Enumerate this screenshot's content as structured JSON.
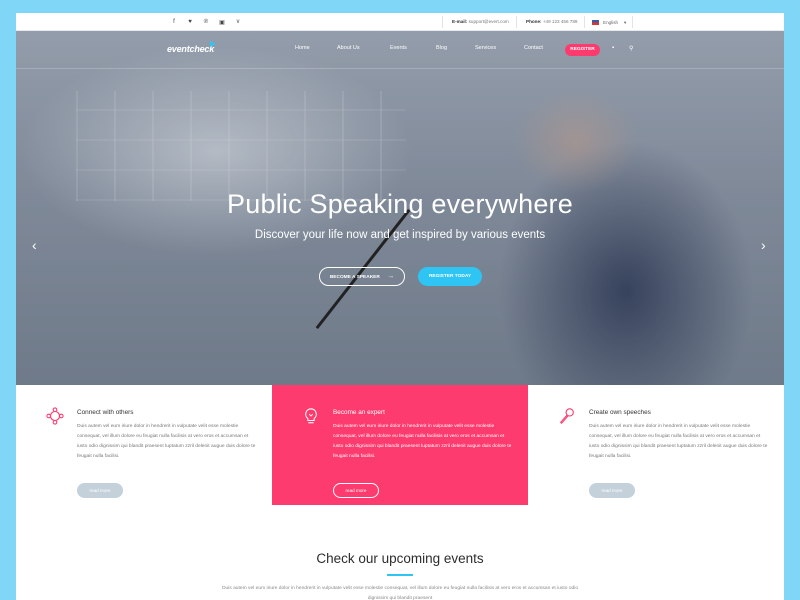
{
  "topbar": {
    "social_icons": [
      "facebook-icon",
      "twitter-icon",
      "pinterest-icon",
      "instagram-icon",
      "vimeo-icon"
    ],
    "email_label": "E-mail:",
    "email_value": "support@evert.com",
    "phone_label": "Phone:",
    "phone_value": "+49 123 456 789",
    "language": "English"
  },
  "nav": {
    "logo": "eventcheck",
    "items": [
      "Home",
      "About Us",
      "Events",
      "Blog",
      "Services",
      "Contact"
    ],
    "register": "REGISTER"
  },
  "hero": {
    "title": "Public Speaking everywhere",
    "subtitle": "Discover your life now and get inspired by various events",
    "btn_speaker": "BECOME A SPEAKER",
    "btn_today": "REGISTER TODAY"
  },
  "features": [
    {
      "title": "Connect with others",
      "text": "Duis autem vel eum iriure dolor in hendrerit in vulputate velit esse molestie consequat, vel illum dolore eu feugiat nulla facilisis at vero eros et accumsan et iusto odio dignissim qui blandit praesent luptatum zzril delenit augue duis dolore te feugait nulla facilisi.",
      "link": "read more"
    },
    {
      "title": "Become an expert",
      "text": "Duis autem vel eum iriure dolor in hendrerit in vulputate velit esse molestie consequat, vel illum dolore eu feugiat nulla facilisis at vero eros et accumsan et iusto odio dignissim qui blandit praesent luptatum zzril delenit augue duis dolore te feugait nulla facilisi.",
      "link": "read more"
    },
    {
      "title": "Create own speeches",
      "text": "Duis autem vel eum iriure dolor in hendrerit in vulputate velit esse molestie consequat, vel illum dolore eu feugiat nulla facilisis at vero eros et accumsan et iusto odio dignissim qui blandit praesent luptatum zzril delenit augue duis dolore te feugait nulla facilisi.",
      "link": "read more"
    }
  ],
  "events": {
    "title": "Check our upcoming events",
    "text": "Duis autem vel eum iriure dolor in hendrerit in vulputate velit esse molestie consequat, vel illum dolore eu feugiat nulla facilisis at vero eros et accumsan et iusto odio dignissim qui blandit praesent"
  },
  "colors": {
    "accent_pink": "#fe3b6e",
    "accent_blue": "#2ec4f3",
    "background": "#7fd6f7"
  }
}
